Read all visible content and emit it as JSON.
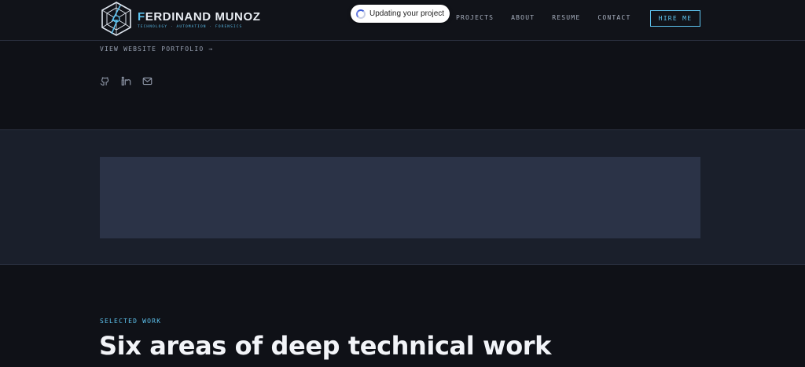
{
  "header": {
    "brand_first_letter": "F",
    "brand_rest": "ERDINAND MUNOZ",
    "brand_tagline": "TECHNOLOGY · AUTOMATION · FORENSICS",
    "nav": [
      {
        "label": "PROJECTS"
      },
      {
        "label": "ABOUT"
      },
      {
        "label": "RESUME"
      },
      {
        "label": "CONTACT"
      }
    ],
    "cta_label": "HIRE ME"
  },
  "toast": {
    "text": "Updating your project",
    "icon": "spinner-icon"
  },
  "hero": {
    "portfolio_link": "VIEW WEBSITE PORTFOLIO →",
    "socials": [
      {
        "icon": "github-icon"
      },
      {
        "icon": "linkedin-icon"
      },
      {
        "icon": "mail-icon"
      }
    ]
  },
  "work": {
    "eyebrow": "SELECTED WORK",
    "headline": "Six areas of deep technical work"
  },
  "colors": {
    "background": "#0f1117",
    "band": "#1a1f2b",
    "panel": "#2b3347",
    "accent": "#5ec4f0"
  }
}
